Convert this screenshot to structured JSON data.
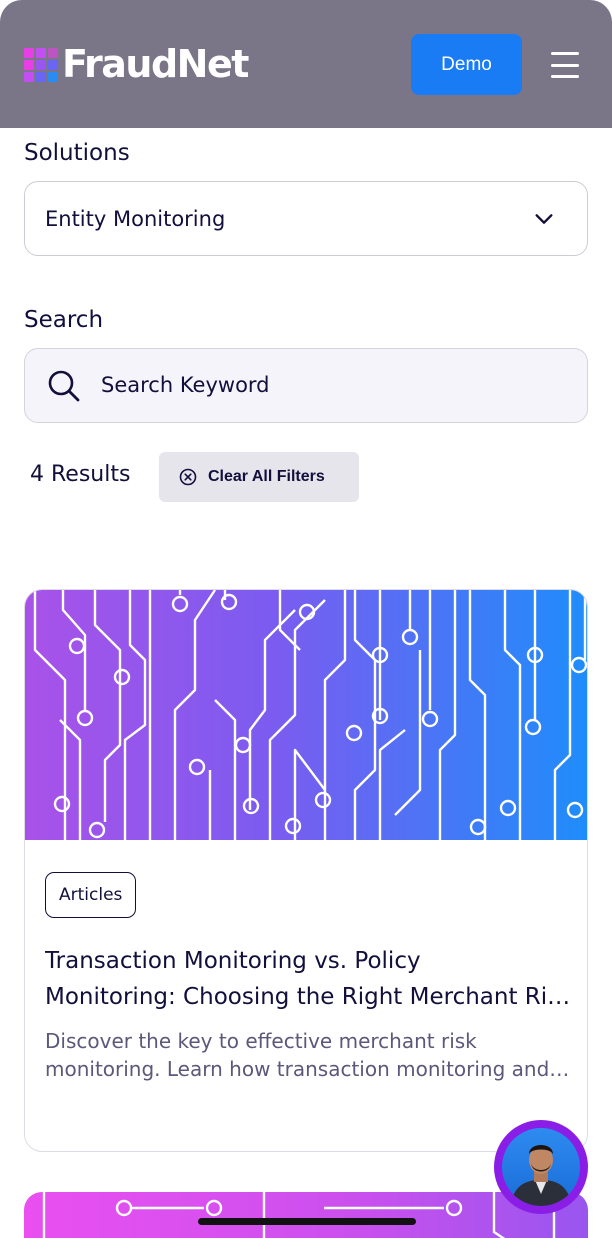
{
  "header": {
    "logo_text": "FraudNet",
    "demo_label": "Demo",
    "brand_colors": {
      "header_bg": "#7a7688",
      "demo_button": "#1a7cf5",
      "logo_pink": "#e83ee8",
      "logo_blue": "#2a8cf0"
    }
  },
  "filters": {
    "solutions_label": "Solutions",
    "solutions_value": "Entity Monitoring",
    "search_label": "Search",
    "search_placeholder": "Search Keyword",
    "results_count": "4 Results",
    "clear_label": "Clear All Filters"
  },
  "cards": [
    {
      "tag": "Articles",
      "title_line1": "Transaction Monitoring vs. Policy",
      "title_line2": "Monitoring: Choosing the Right Merchant Risk Strategy",
      "desc_line1": "Discover the key to effective merchant risk",
      "desc_line2": "monitoring. Learn how transaction monitoring and policy monitoring"
    }
  ],
  "icons": {
    "menu": "hamburger-icon",
    "chevron": "chevron-down-icon",
    "search": "search-icon",
    "clear": "close-circle-icon",
    "chat": "chat-avatar-icon"
  }
}
